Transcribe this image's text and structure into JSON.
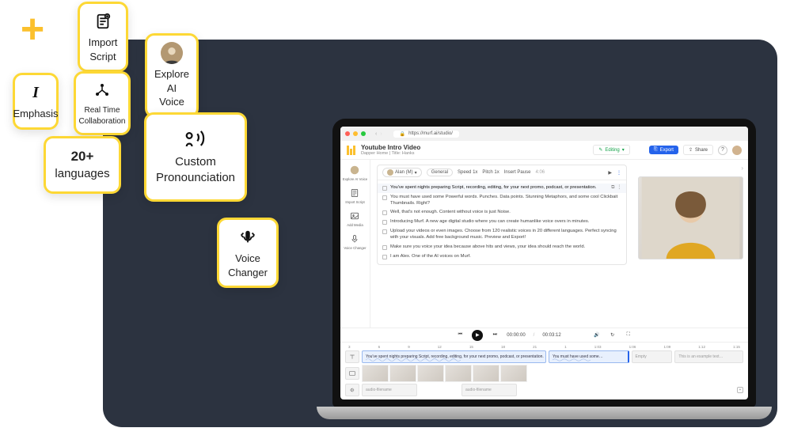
{
  "plus_symbol": "+",
  "cards": {
    "import_script": {
      "l1": "Import",
      "l2": "Script"
    },
    "explore_ai_voice": {
      "l1": "Explore AI",
      "l2": "Voice"
    },
    "emphasis": {
      "l1": "Emphasis"
    },
    "collab": {
      "l1": "Real Time",
      "l2": "Collaboration"
    },
    "languages": {
      "l1": "20+",
      "l2": "languages"
    },
    "pronounce": {
      "l1": "Custom",
      "l2": "Pronounciation"
    },
    "voice_changer": {
      "l1": "Voice",
      "l2": "Changer"
    }
  },
  "browser": {
    "lock_icon": "lock",
    "url": "https://murf.ai/studio/"
  },
  "app": {
    "title": "Youtube Intro Video",
    "breadcrumb_a": "Dapper Home",
    "breadcrumb_b": "Title: Hanks",
    "edit_label": "Editing",
    "export_label": "Export",
    "share_label": "Share",
    "help_icon": "?"
  },
  "sidebar": [
    {
      "key": "explore",
      "label": "Explore AI Voice"
    },
    {
      "key": "import",
      "label": "Import Script"
    },
    {
      "key": "media",
      "label": "Add Media"
    },
    {
      "key": "changer",
      "label": "Voice Changer"
    }
  ],
  "script_head": {
    "voice_name": "Alan (M)",
    "general": "General",
    "speed": "Speed 1x",
    "pitch": "Pitch 1x",
    "pause": "Insert Pause",
    "dur": "4:06"
  },
  "script_lines": [
    "You've spent nights preparing Script, recording, editing, for your next promo, podcast, or presentation.",
    "You must have used some Powerful words. Punches. Data points. Stunning Metaphors, and some cool Clickbait Thumbnails. Right?",
    "Well, that's not enough. Content without voice is just Noise.",
    "Introducing Murf. A new age digital studio where you can create humanlike voice overs in minutes.",
    "Upload your videos or even images.\nChoose from 120 realistic voices in 20 different languages.\nPerfect syncing with your visuals.\nAdd free background music.\nPreview and Export!",
    "Make sure you voice your idea because above hits and views,  your idea should reach the world.",
    "I am Alex. One of the AI voices on Murf."
  ],
  "transport": {
    "time_cur": "00:00:00",
    "time_tot": "00:03:12"
  },
  "ruler": [
    "3",
    "6",
    "9",
    "12",
    "15",
    "18",
    "21",
    "1",
    "1:03",
    "1:06",
    "1:09",
    "1:12",
    "1:15"
  ],
  "timeline": {
    "clip_a": "You've spent nights preparing Script, recording, editing, for your next promo, podcast, or presentation.",
    "clip_b": "You must have used some…",
    "empty": "Empty",
    "example": "This is an example text…",
    "audio_a": "audio-filename",
    "audio_b": "audio-filename"
  }
}
